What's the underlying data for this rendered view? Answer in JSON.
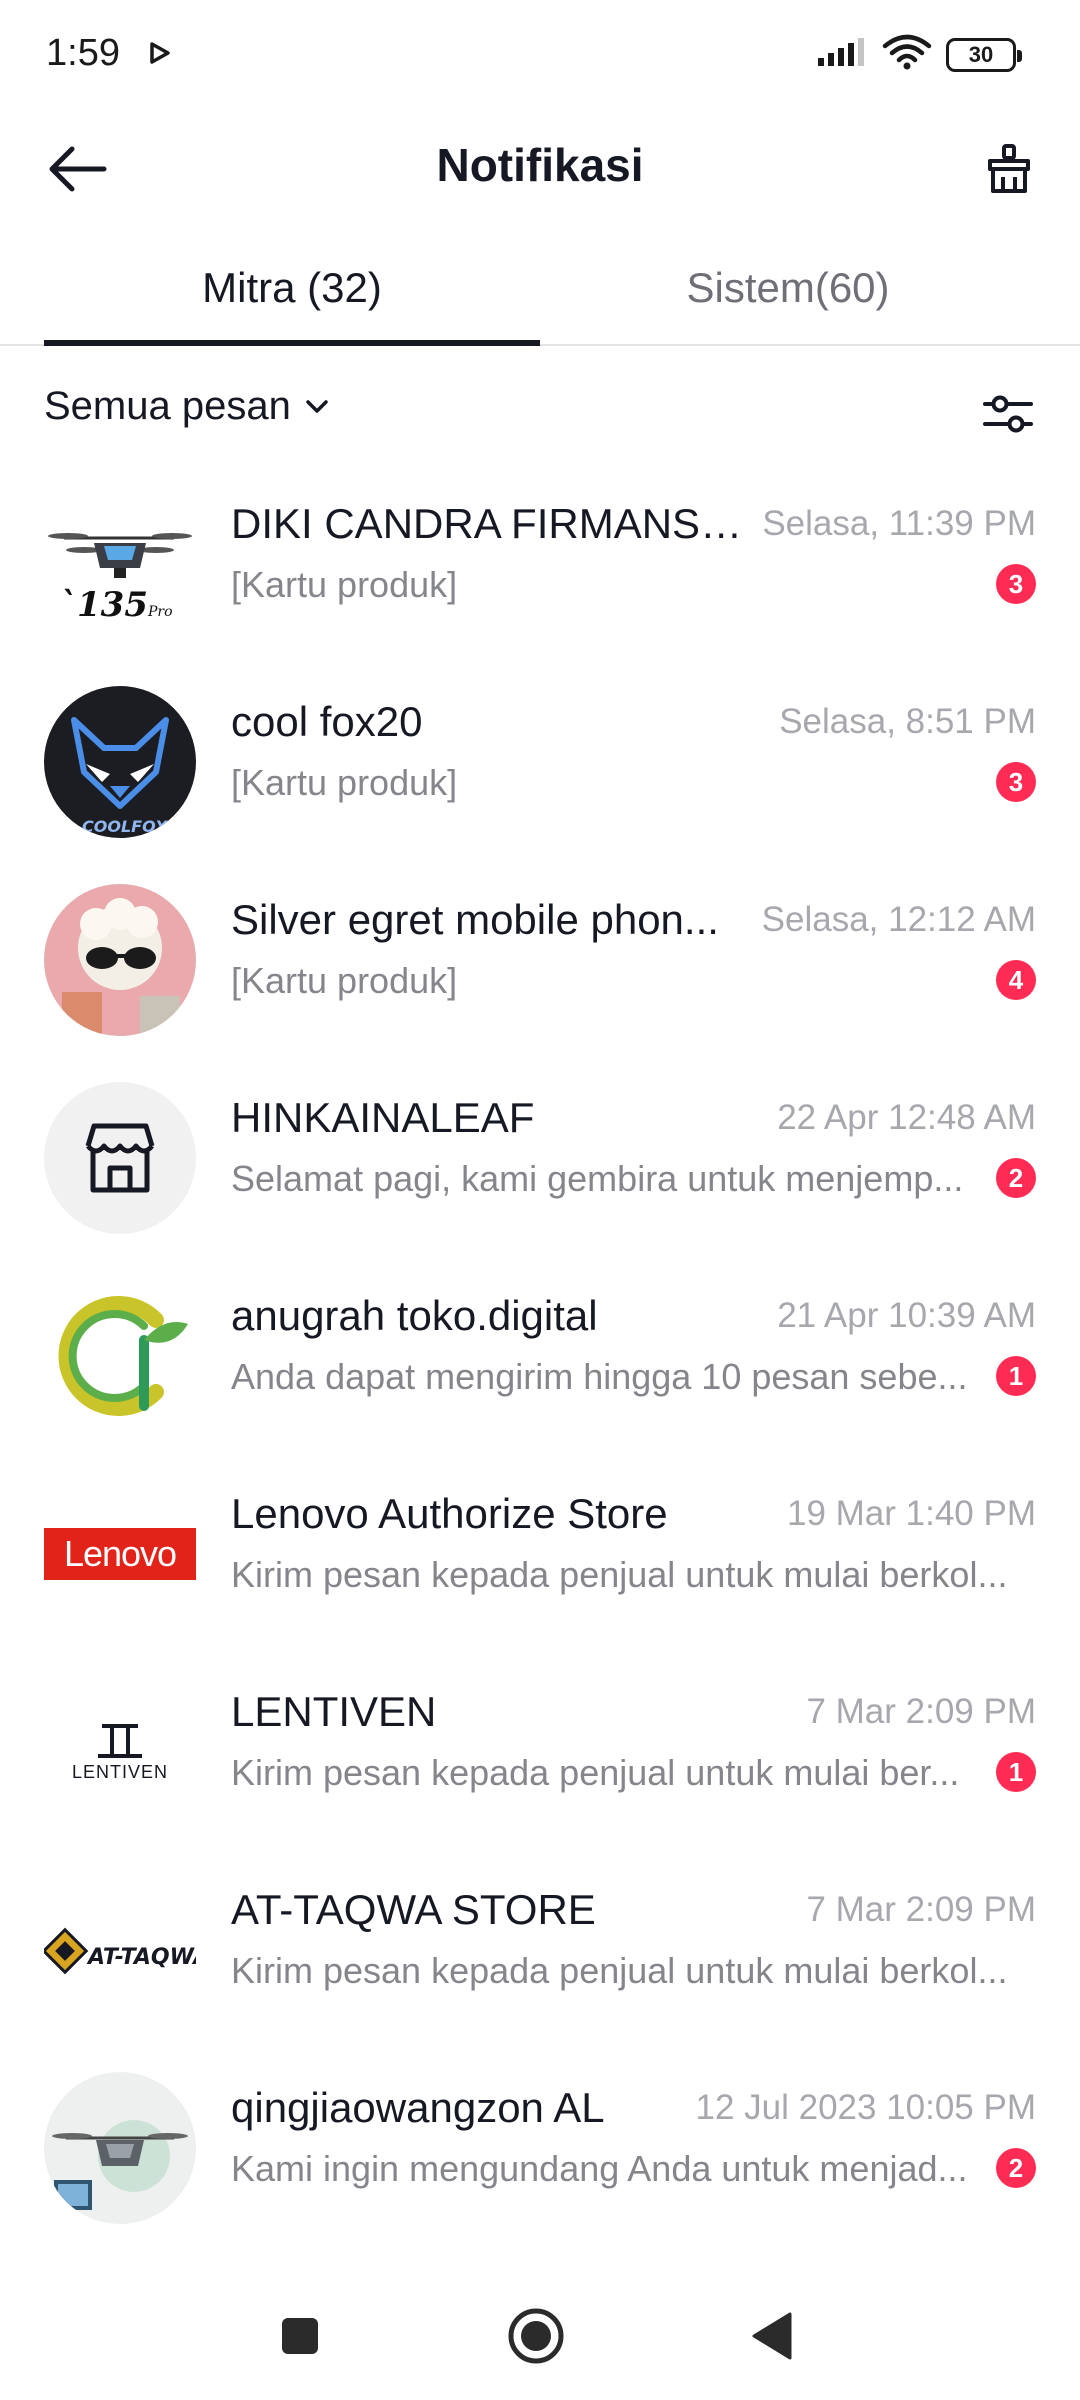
{
  "status_bar": {
    "time": "1:59",
    "battery": "30",
    "icons": [
      "play-icon",
      "signal-icon",
      "wifi-icon",
      "battery-icon"
    ]
  },
  "header": {
    "title": "Notifikasi",
    "back_icon": "arrow-left-icon",
    "clear_icon": "broom-icon"
  },
  "tabs": [
    {
      "label": "Mitra (32)",
      "active": true
    },
    {
      "label": "Sistem(60)",
      "active": false
    }
  ],
  "filter": {
    "label": "Semua pesan",
    "dropdown_icon": "chevron-down-icon",
    "settings_icon": "sliders-icon"
  },
  "colors": {
    "badge": "#fe2c55",
    "text_primary": "#161823",
    "text_secondary": "#85868c",
    "time": "#a7a8ad"
  },
  "conversations": [
    {
      "name": "DIKI CANDRA FIRMANSY...",
      "time": "Selasa, 11:39 PM",
      "message": "[Kartu produk]",
      "badge": "3",
      "avatar": "drone-avatar"
    },
    {
      "name": "cool fox20",
      "time": "Selasa, 8:51 PM",
      "message": "[Kartu produk]",
      "badge": "3",
      "avatar": "fox-avatar"
    },
    {
      "name": "Silver egret mobile phon...",
      "time": "Selasa, 12:12 AM",
      "message": "[Kartu produk]",
      "badge": "4",
      "avatar": "sunglasses-avatar"
    },
    {
      "name": "HINKAINALEAF",
      "time": "22 Apr 12:48 AM",
      "message": "Selamat pagi, kami gembira untuk menjemp...",
      "badge": "2",
      "avatar": "store-icon"
    },
    {
      "name": "anugrah toko.digital",
      "time": "21 Apr 10:39 AM",
      "message": "Anda dapat mengirim hingga 10 pesan sebe...",
      "badge": "1",
      "avatar": "leaf-logo-avatar"
    },
    {
      "name": "Lenovo Authorize Store",
      "time": "19 Mar 1:40 PM",
      "message": "Kirim pesan kepada penjual untuk mulai berkol...",
      "badge": "",
      "avatar": "lenovo-logo",
      "logo_text": "Lenovo"
    },
    {
      "name": "LENTIVEN",
      "time": "7 Mar 2:09 PM",
      "message": "Kirim pesan kepada penjual untuk mulai ber...",
      "badge": "1",
      "avatar": "lentiven-logo",
      "logo_text": "LENTIVEN"
    },
    {
      "name": "AT-TAQWA STORE",
      "time": "7 Mar 2:09 PM",
      "message": "Kirim pesan kepada penjual untuk mulai berkol...",
      "badge": "",
      "avatar": "at-taqwa-logo",
      "logo_text": "AT-TAQWA"
    },
    {
      "name": "qingjiaowangzon AL",
      "time": "12 Jul 2023 10:05 PM",
      "message": "Kami ingin mengundang Anda untuk menjad...",
      "badge": "2",
      "avatar": "drone-photo-avatar"
    }
  ],
  "nav_bar": {
    "buttons": [
      "recents-icon",
      "home-icon",
      "back-triangle-icon"
    ]
  }
}
